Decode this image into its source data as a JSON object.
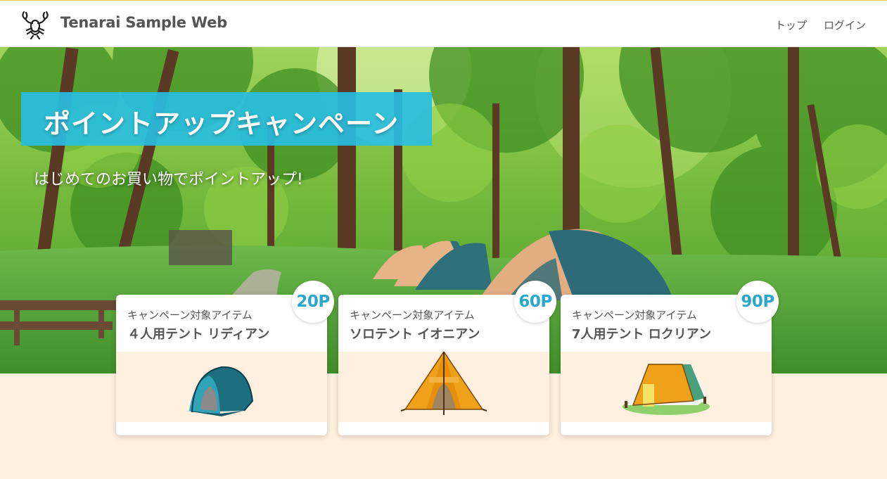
{
  "header": {
    "site_title": "Tenarai Sample Web",
    "logo_icon": "lobster-icon",
    "nav": [
      {
        "label": "トップ"
      },
      {
        "label": "ログイン"
      }
    ],
    "accent_color": "#e8c84a"
  },
  "hero": {
    "title": "ポイントアップキャンペーン",
    "subtitle": "はじめてのお買い物でポイントアップ!",
    "title_bg_color": "#28bee1"
  },
  "cards": [
    {
      "label": "キャンペーン対象アイテム",
      "name": "４人用テント リディアン",
      "points": "20P",
      "icon": "dome-tent-icon"
    },
    {
      "label": "キャンペーン対象アイテム",
      "name": "ソロテント イオニアン",
      "points": "60P",
      "icon": "teepee-tent-icon"
    },
    {
      "label": "キャンペーン対象アイテム",
      "name": "7人用テント ロクリアン",
      "points": "90P",
      "icon": "family-tent-icon"
    }
  ],
  "colors": {
    "points": "#2aa8cc",
    "page_bg": "#fff0e0"
  }
}
